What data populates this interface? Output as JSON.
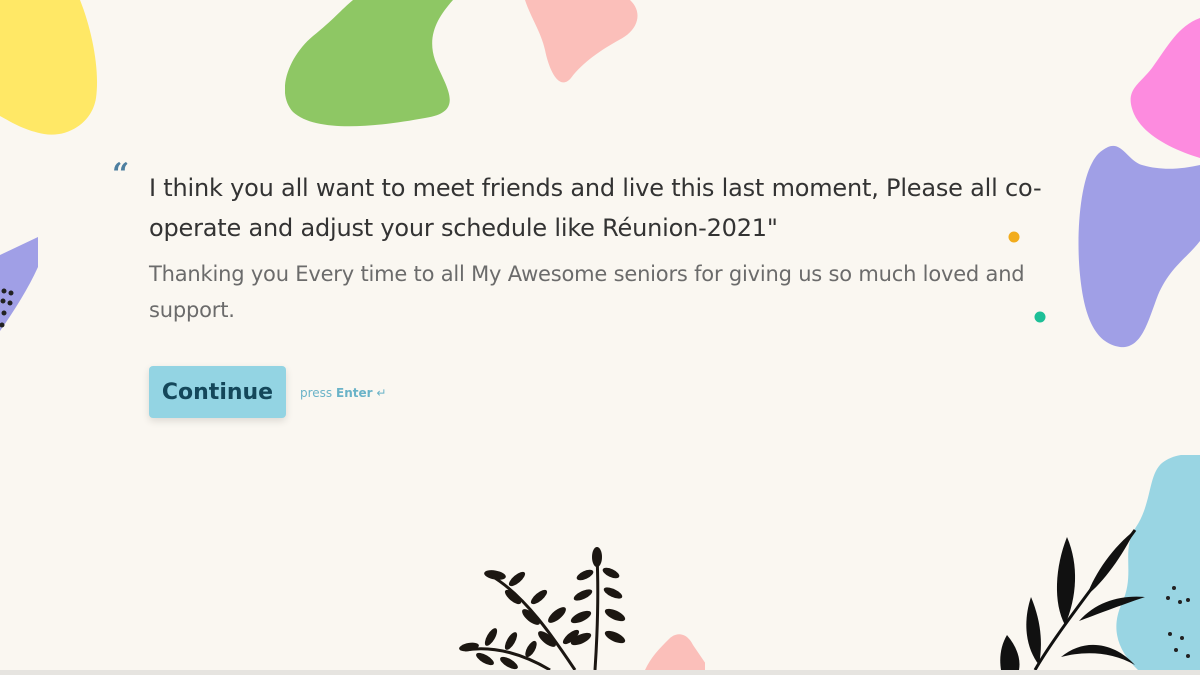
{
  "quote": {
    "question": "I think you all want to meet friends and live this last moment, Please all co-operate and adjust your schedule like Réunion-2021\"",
    "description": "Thanking you Every time to all My Awesome seniors for giving us so much loved and support."
  },
  "actions": {
    "continue_label": "Continue",
    "press_prefix": "press",
    "press_key": "Enter",
    "press_icon": "↵"
  },
  "colors": {
    "background": "#faf7f1",
    "button": "#93d4e3",
    "button_text": "#14475a",
    "quote_mark": "#4d7fa0",
    "blob_yellow": "#ffe866",
    "blob_green": "#8ec764",
    "blob_pink": "#fbbfba",
    "blob_magenta": "#fd8bdf",
    "blob_purple": "#a09fe6",
    "blob_blue": "#99d5e3",
    "dot_orange": "#f2ac1c",
    "dot_teal": "#1dbf97"
  }
}
